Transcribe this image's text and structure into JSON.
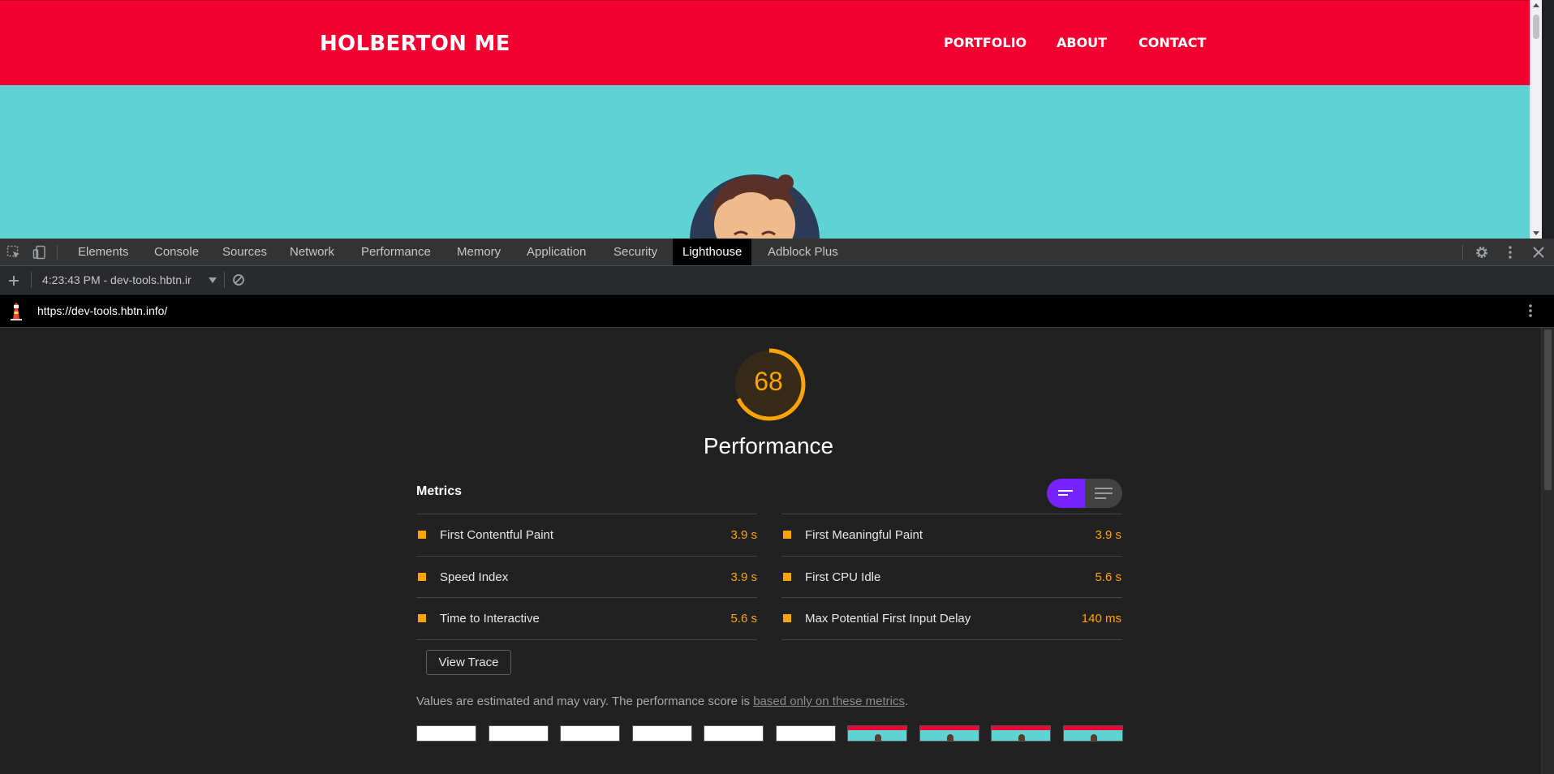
{
  "site": {
    "logo": "HOLBERTON ME",
    "nav": [
      "PORTFOLIO",
      "ABOUT",
      "CONTACT"
    ]
  },
  "devtools": {
    "tabs": [
      "Elements",
      "Console",
      "Sources",
      "Network",
      "Performance",
      "Memory",
      "Application",
      "Security",
      "Lighthouse",
      "Adblock Plus"
    ],
    "active_tab": "Lighthouse",
    "report_selector": "4:23:43 PM - dev-tools.hbtn.ir",
    "url": "https://dev-tools.hbtn.info/"
  },
  "report": {
    "score": "68",
    "category": "Performance",
    "metrics_heading": "Metrics",
    "metrics": [
      {
        "label": "First Contentful Paint",
        "value": "3.9 s"
      },
      {
        "label": "First Meaningful Paint",
        "value": "3.9 s"
      },
      {
        "label": "Speed Index",
        "value": "3.9 s"
      },
      {
        "label": "First CPU Idle",
        "value": "5.6 s"
      },
      {
        "label": "Time to Interactive",
        "value": "5.6 s"
      },
      {
        "label": "Max Potential First Input Delay",
        "value": "140 ms"
      }
    ],
    "view_trace": "View Trace",
    "note_prefix": "Values are estimated and may vary. The performance score is ",
    "note_link": "based only on these metrics",
    "note_suffix": ".",
    "filmstrip_frames": 10,
    "filmstrip_loaded_from": 6
  },
  "colors": {
    "site_header": "#f20030",
    "site_body": "#5fd3d3",
    "score_average": "#ffa400",
    "toggle_active": "#7722ff"
  },
  "icons": {
    "inspect": "inspect-element-icon",
    "device": "device-toolbar-icon",
    "settings": "gear-icon",
    "more": "kebab-menu-icon",
    "close": "close-icon",
    "add": "plus-icon",
    "clear": "block-icon",
    "lighthouse": "lighthouse-logo-icon"
  }
}
